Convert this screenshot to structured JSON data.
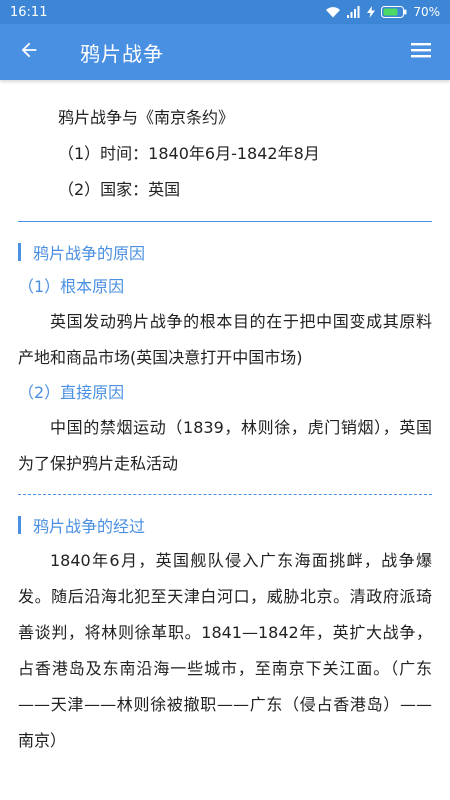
{
  "status_bar": {
    "time": "16:11",
    "battery": "70%"
  },
  "app_bar": {
    "title": "鸦片战争"
  },
  "intro": {
    "heading": "鸦片战争与《南京条约》",
    "time_line": "（1）时间：1840年6月-1842年8月",
    "country_line": "（2）国家：英国"
  },
  "sections": [
    {
      "title": "鸦片战争的原因",
      "sub1": "（1）根本原因",
      "para1": "英国发动鸦片战争的根本目的在于把中国变成其原料产地和商品市场(英国决意打开中国市场)",
      "sub2": "（2）直接原因",
      "para2": "中国的禁烟运动（1839，林则徐，虎门销烟），英国为了保护鸦片走私活动"
    },
    {
      "title": "鸦片战争的经过",
      "para1": "1840年6月，英国舰队侵入广东海面挑衅，战争爆发。随后沿海北犯至天津白河口，威胁北京。清政府派琦善谈判，将林则徐革职。1841—1842年，英扩大战争，占香港岛及东南沿海一些城市，至南京下关江面。（广东——天津——林则徐被撤职——广东（侵占香港岛）——南京）"
    }
  ],
  "icons": {
    "back": "arrow-left-icon",
    "menu": "hamburger-menu-icon",
    "wifi": "wifi-icon",
    "signal": "signal-icon",
    "battery": "battery-icon"
  },
  "colors": {
    "primary": "#4a90e2",
    "status_bar": "#3d86d6",
    "battery_fill": "#4cd964"
  }
}
